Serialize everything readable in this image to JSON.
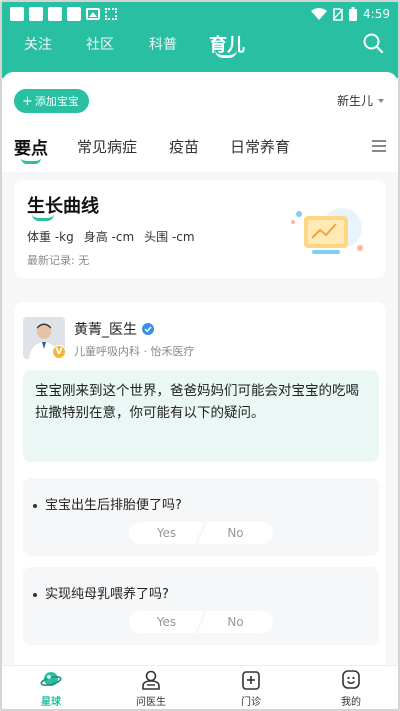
{
  "status_bar": {
    "time": "4:59"
  },
  "top_nav": {
    "tabs": [
      {
        "label": "关注"
      },
      {
        "label": "社区"
      },
      {
        "label": "科普"
      },
      {
        "label": "育儿"
      }
    ],
    "active_tab": "育儿"
  },
  "baby_bar": {
    "add_button": "添加宝宝",
    "stage": "新生儿"
  },
  "sub_tabs": [
    "要点",
    "常见病症",
    "疫苗",
    "日常养育"
  ],
  "growth_card": {
    "title": "生长曲线",
    "weight": "体重 -kg",
    "height": "身高 -cm",
    "head": "头围 -cm",
    "latest": "最新记录: 无"
  },
  "doctor_card": {
    "name": "黄菁_医生",
    "department": "儿童呼吸内科 · 怡禾医疗",
    "badge": "V",
    "message": "宝宝刚来到这个世界，爸爸妈妈们可能会对宝宝的吃喝拉撒特别在意，你可能有以下的疑问。",
    "questions": [
      {
        "text": "宝宝出生后排胎便了吗?",
        "yes": "Yes",
        "no": "No"
      },
      {
        "text": "实现纯母乳喂养了吗?",
        "yes": "Yes",
        "no": "No"
      }
    ]
  },
  "bottom_nav": [
    {
      "label": "星球"
    },
    {
      "label": "问医生"
    },
    {
      "label": "门诊"
    },
    {
      "label": "我的"
    }
  ],
  "colors": {
    "accent": "#29bfa3",
    "bubble": "#eaf7f4",
    "badge": "#f4b73b",
    "verify": "#3a8fe8"
  }
}
